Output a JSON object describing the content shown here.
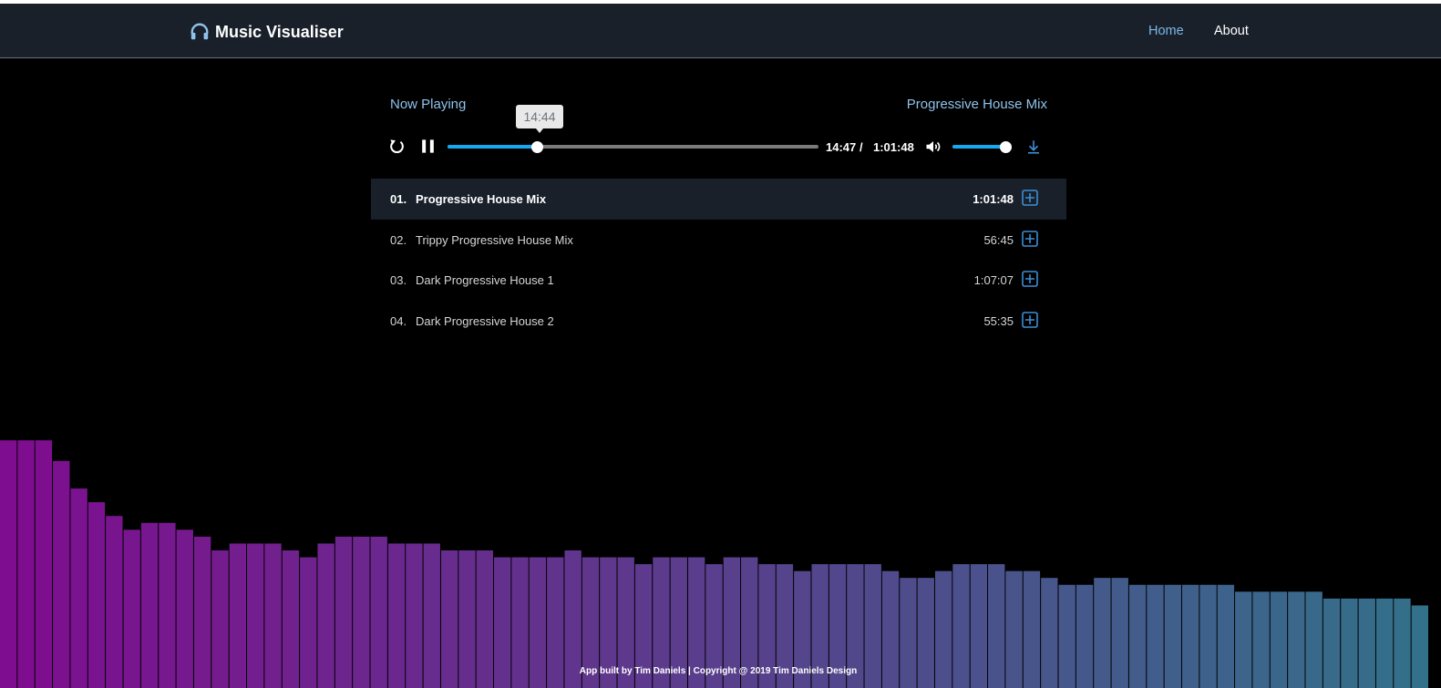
{
  "app": {
    "title": "Music Visualiser",
    "brand_icon": "headphones-icon",
    "accent": "#14a9f0",
    "navbar_bg": "#19202a"
  },
  "nav": {
    "home": "Home",
    "about": "About"
  },
  "player": {
    "now_playing_label": "Now Playing",
    "current_track": "Progressive House Mix",
    "tooltip_time": "14:44",
    "current_time": "14:47",
    "time_separator": "/",
    "total_time": "1:01:48",
    "progress_fraction": 0.24,
    "volume_fraction": 0.95,
    "icons": {
      "replay": "replay-icon",
      "pause": "pause-icon",
      "volume": "volume-icon",
      "download": "download-icon"
    }
  },
  "playlist": [
    {
      "num": "01.",
      "name": "Progressive House Mix",
      "duration": "1:01:48",
      "active": true
    },
    {
      "num": "02.",
      "name": "Trippy Progressive House Mix",
      "duration": "56:45",
      "active": false
    },
    {
      "num": "03.",
      "name": "Dark Progressive House 1",
      "duration": "1:07:07",
      "active": false
    },
    {
      "num": "04.",
      "name": "Dark Progressive House 2",
      "duration": "55:35",
      "active": false
    }
  ],
  "visualizer": {
    "levels": [
      0.36,
      0.36,
      0.36,
      0.33,
      0.29,
      0.27,
      0.25,
      0.23,
      0.24,
      0.24,
      0.23,
      0.22,
      0.2,
      0.21,
      0.21,
      0.21,
      0.2,
      0.19,
      0.21,
      0.22,
      0.22,
      0.22,
      0.21,
      0.21,
      0.21,
      0.2,
      0.2,
      0.2,
      0.19,
      0.19,
      0.19,
      0.19,
      0.2,
      0.19,
      0.19,
      0.19,
      0.18,
      0.19,
      0.19,
      0.19,
      0.18,
      0.19,
      0.19,
      0.18,
      0.18,
      0.17,
      0.18,
      0.18,
      0.18,
      0.18,
      0.17,
      0.16,
      0.16,
      0.17,
      0.18,
      0.18,
      0.18,
      0.17,
      0.17,
      0.16,
      0.15,
      0.15,
      0.16,
      0.16,
      0.15,
      0.15,
      0.15,
      0.15,
      0.15,
      0.15,
      0.14,
      0.14,
      0.14,
      0.14,
      0.14,
      0.13,
      0.13,
      0.13,
      0.13,
      0.13,
      0.12
    ],
    "color_start": "#7f0d8f",
    "color_end": "#33708a"
  },
  "footer": {
    "text": "App built by Tim Daniels | Copyright @ 2019 Tim Daniels Design"
  }
}
